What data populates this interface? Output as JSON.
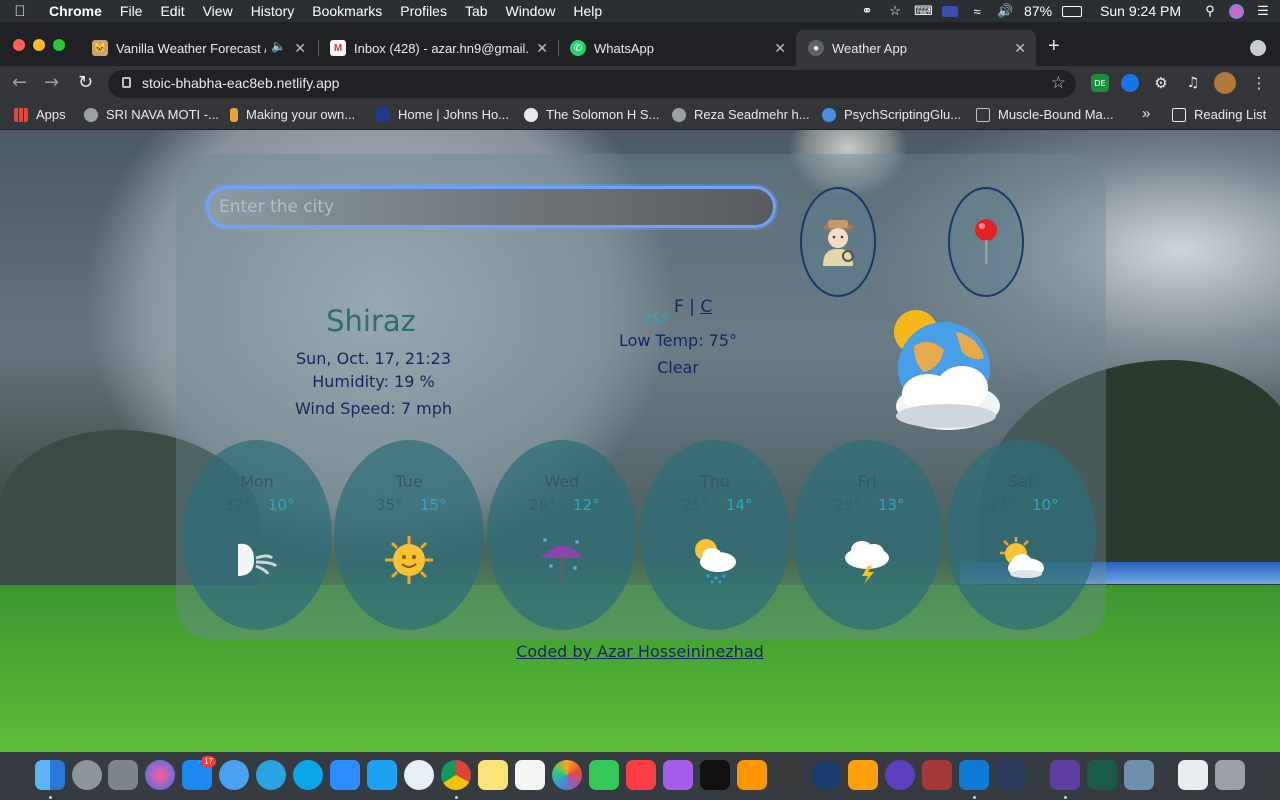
{
  "menubar": {
    "app": "Chrome",
    "items": [
      "File",
      "Edit",
      "View",
      "History",
      "Bookmarks",
      "Profiles",
      "Tab",
      "Window",
      "Help"
    ],
    "battery": "87%",
    "clock": "Sun 9:24 PM"
  },
  "tabs": [
    {
      "title": "Vanilla Weather Forecast / ",
      "active": false
    },
    {
      "title": "Inbox (428) - azar.hn9@gmail.",
      "active": false
    },
    {
      "title": "WhatsApp",
      "active": false
    },
    {
      "title": "Weather App",
      "active": true
    }
  ],
  "toolbar": {
    "url": "stoic-bhabha-eac8eb.netlify.app",
    "ext_badge": "DE"
  },
  "bookmarks": {
    "apps": "Apps",
    "items": [
      "SRI NAVA MOTI -...",
      "Making your own...",
      "Home | Johns Ho...",
      "The Solomon H S...",
      "Reza Seadmehr h...",
      "PsychScriptingGlu...",
      "Muscle-Bound Ma..."
    ],
    "overflow": "»",
    "reading_list": "Reading List"
  },
  "weather": {
    "search_placeholder": "Enter the city",
    "city": "Shiraz",
    "date": "Sun, Oct. 17, 21:23",
    "humidity": "Humidity: 19 %",
    "wind": "Wind Speed: 7 mph",
    "current_temp": "75°",
    "unit_f": "F",
    "unit_sep": "|",
    "unit_c": "C",
    "low_temp": "Low Temp: 75°",
    "description": "Clear",
    "forecast": [
      {
        "day": "Mon",
        "high": "32°",
        "low": "10°",
        "icon": "wind-face-icon"
      },
      {
        "day": "Tue",
        "high": "35°",
        "low": "15°",
        "icon": "sun-icon"
      },
      {
        "day": "Wed",
        "high": "28°",
        "low": "12°",
        "icon": "umbrella-rain-icon"
      },
      {
        "day": "Thu",
        "high": "25°",
        "low": "14°",
        "icon": "sun-rain-cloud-icon"
      },
      {
        "day": "Fri",
        "high": "23°",
        "low": "13°",
        "icon": "thunder-cloud-icon"
      },
      {
        "day": "Sat",
        "high": "27°",
        "low": "10°",
        "icon": "sun-behind-cloud-icon"
      }
    ],
    "credit": "Coded by Azar Hosseininezhad"
  },
  "dock": {
    "appstore_badge": "17"
  }
}
